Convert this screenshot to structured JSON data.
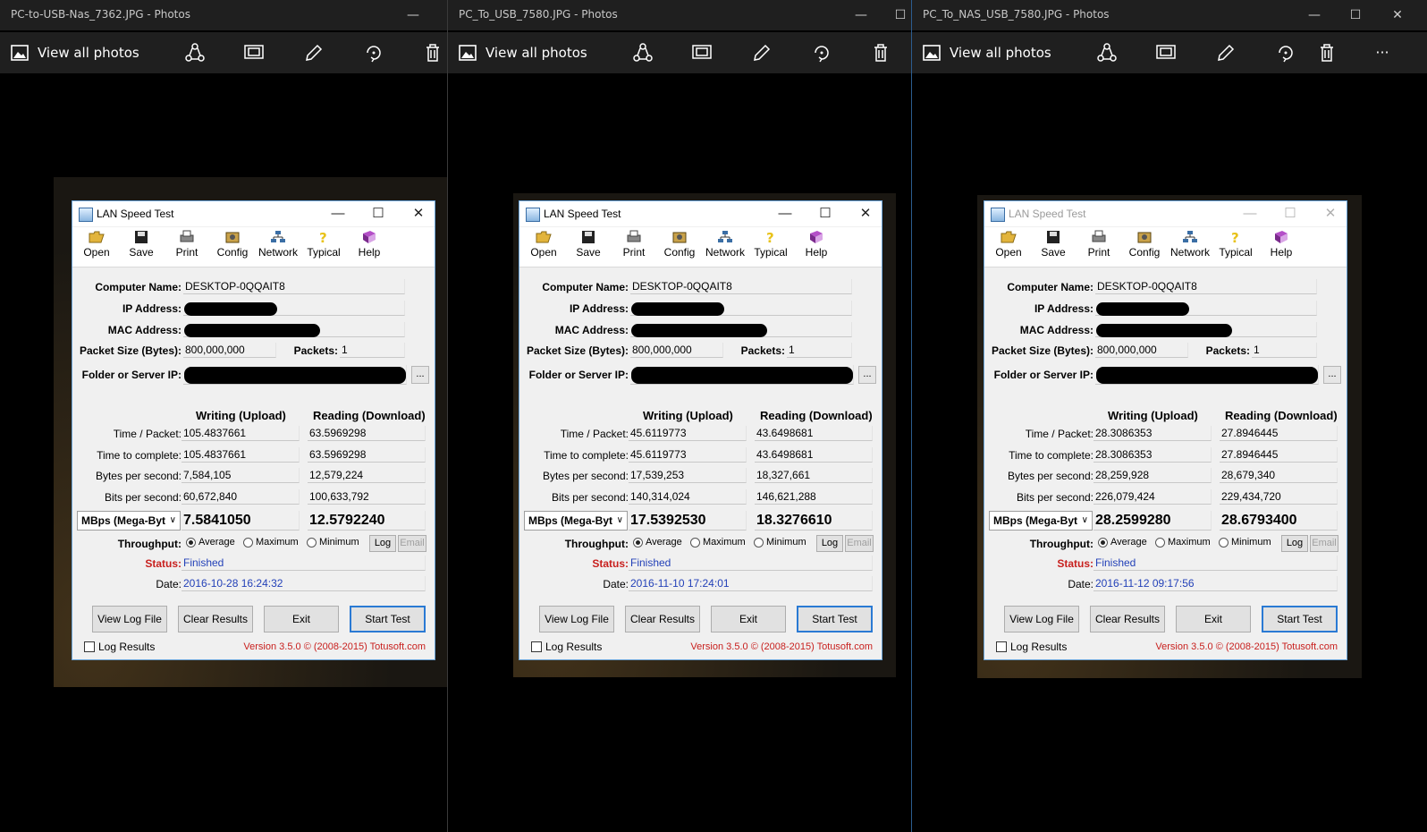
{
  "windows": [
    {
      "title": "PC-to-USB-Nas_7362.JPG - Photos",
      "view_all": "View all photos",
      "lst": {
        "title": "LAN Speed Test",
        "toolbar": [
          "Open",
          "Save",
          "Print",
          "Config",
          "Network",
          "Typical",
          "Help"
        ],
        "computer_name_label": "Computer Name:",
        "computer_name": "DESKTOP-0QQAIT8",
        "ip_label": "IP Address:",
        "mac_label": "MAC Address:",
        "packet_size_label": "Packet Size (Bytes):",
        "packet_size": "800,000,000",
        "packets_label": "Packets:",
        "packets": "1",
        "folder_label": "Folder or Server IP:",
        "folder_button": "...",
        "write_header": "Writing (Upload)",
        "read_header": "Reading (Download)",
        "row_labels": [
          "Time / Packet:",
          "Time to complete:",
          "Bytes per second:",
          "Bits per second:"
        ],
        "write": [
          "105.4837661",
          "105.4837661",
          "7,584,105",
          "60,672,840"
        ],
        "read": [
          "63.5969298",
          "63.5969298",
          "12,579,224",
          "100,633,792"
        ],
        "unit": "MBps (Mega-Byt",
        "write_mbps": "7.5841050",
        "read_mbps": "12.5792240",
        "throughput_label": "Throughput:",
        "opt_average": "Average",
        "opt_maximum": "Maximum",
        "opt_minimum": "Minimum",
        "log_btn": "Log",
        "email_btn": "Email",
        "status_label": "Status:",
        "status": "Finished",
        "date_label": "Date:",
        "date": "2016-10-28 16:24:32",
        "btn_view_log": "View Log File",
        "btn_clear": "Clear Results",
        "btn_exit": "Exit",
        "btn_start": "Start Test",
        "log_results": "Log Results",
        "version": "Version 3.5.0  © (2008-2015) Totusoft.com"
      }
    },
    {
      "title": "PC_To_USB_7580.JPG - Photos",
      "view_all": "View all photos",
      "lst": {
        "title": "LAN Speed Test",
        "toolbar": [
          "Open",
          "Save",
          "Print",
          "Config",
          "Network",
          "Typical",
          "Help"
        ],
        "computer_name_label": "Computer Name:",
        "computer_name": "DESKTOP-0QQAIT8",
        "ip_label": "IP Address:",
        "mac_label": "MAC Address:",
        "packet_size_label": "Packet Size (Bytes):",
        "packet_size": "800,000,000",
        "packets_label": "Packets:",
        "packets": "1",
        "folder_label": "Folder or Server IP:",
        "folder_button": "...",
        "write_header": "Writing (Upload)",
        "read_header": "Reading (Download)",
        "row_labels": [
          "Time / Packet:",
          "Time to complete:",
          "Bytes per second:",
          "Bits per second:"
        ],
        "write": [
          "45.6119773",
          "45.6119773",
          "17,539,253",
          "140,314,024"
        ],
        "read": [
          "43.6498681",
          "43.6498681",
          "18,327,661",
          "146,621,288"
        ],
        "unit": "MBps (Mega-Byt",
        "write_mbps": "17.5392530",
        "read_mbps": "18.3276610",
        "throughput_label": "Throughput:",
        "opt_average": "Average",
        "opt_maximum": "Maximum",
        "opt_minimum": "Minimum",
        "log_btn": "Log",
        "email_btn": "Email",
        "status_label": "Status:",
        "status": "Finished",
        "date_label": "Date:",
        "date": "2016-11-10 17:24:01",
        "btn_view_log": "View Log File",
        "btn_clear": "Clear Results",
        "btn_exit": "Exit",
        "btn_start": "Start Test",
        "log_results": "Log Results",
        "version": "Version 3.5.0  © (2008-2015) Totusoft.com"
      }
    },
    {
      "title": "PC_To_NAS_USB_7580.JPG - Photos",
      "view_all": "View all photos",
      "more": "···",
      "lst": {
        "title": "LAN Speed Test",
        "toolbar": [
          "Open",
          "Save",
          "Print",
          "Config",
          "Network",
          "Typical",
          "Help"
        ],
        "computer_name_label": "Computer Name:",
        "computer_name": "DESKTOP-0QQAIT8",
        "ip_label": "IP Address:",
        "mac_label": "MAC Address:",
        "packet_size_label": "Packet Size (Bytes):",
        "packet_size": "800,000,000",
        "packets_label": "Packets:",
        "packets": "1",
        "folder_label": "Folder or Server IP:",
        "folder_button": "...",
        "write_header": "Writing (Upload)",
        "read_header": "Reading (Download)",
        "row_labels": [
          "Time / Packet:",
          "Time to complete:",
          "Bytes per second:",
          "Bits per second:"
        ],
        "write": [
          "28.3086353",
          "28.3086353",
          "28,259,928",
          "226,079,424"
        ],
        "read": [
          "27.8946445",
          "27.8946445",
          "28,679,340",
          "229,434,720"
        ],
        "unit": "MBps (Mega-Byt",
        "write_mbps": "28.2599280",
        "read_mbps": "28.6793400",
        "throughput_label": "Throughput:",
        "opt_average": "Average",
        "opt_maximum": "Maximum",
        "opt_minimum": "Minimum",
        "log_btn": "Log",
        "email_btn": "Email",
        "status_label": "Status:",
        "status": "Finished",
        "date_label": "Date:",
        "date": "2016-11-12 09:17:56",
        "btn_view_log": "View Log File",
        "btn_clear": "Clear Results",
        "btn_exit": "Exit",
        "btn_start": "Start Test",
        "log_results": "Log Results",
        "version": "Version 3.5.0  © (2008-2015) Totusoft.com"
      }
    }
  ]
}
